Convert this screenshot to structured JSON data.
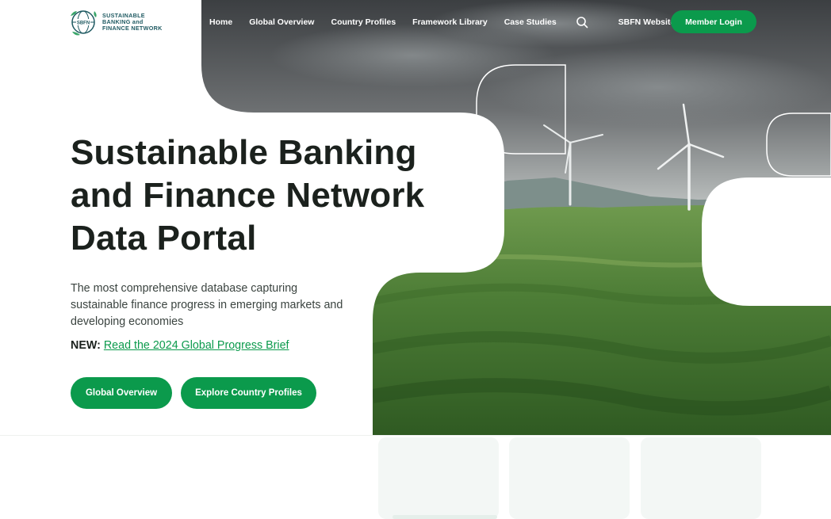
{
  "logo": {
    "mark_text": "SBFN",
    "line1": "SUSTAINABLE",
    "line2": "BANKING and",
    "line3": "FINANCE NETWORK"
  },
  "nav": {
    "items": [
      "Home",
      "Global Overview",
      "Country Profiles",
      "Framework Library",
      "Case Studies"
    ],
    "search_icon": "search-icon",
    "external_label": "SBFN Website",
    "external_icon": "arrow-up-right-icon",
    "member_login": "Member Login"
  },
  "hero": {
    "title_line1": "Sustainable Banking",
    "title_line2": "and Finance Network",
    "title_line3": "Data Portal",
    "subtitle": "The most comprehensive database capturing sustainable finance progress in emerging markets and developing economies",
    "news_label": "NEW:",
    "news_link": "Read the 2024 Global Progress Brief",
    "primary_button": "Global Overview",
    "secondary_button": "Explore Country Profiles"
  },
  "colors": {
    "accent": "#0b9a4c",
    "logo": "#1f5a62",
    "text": "#1b211d"
  }
}
